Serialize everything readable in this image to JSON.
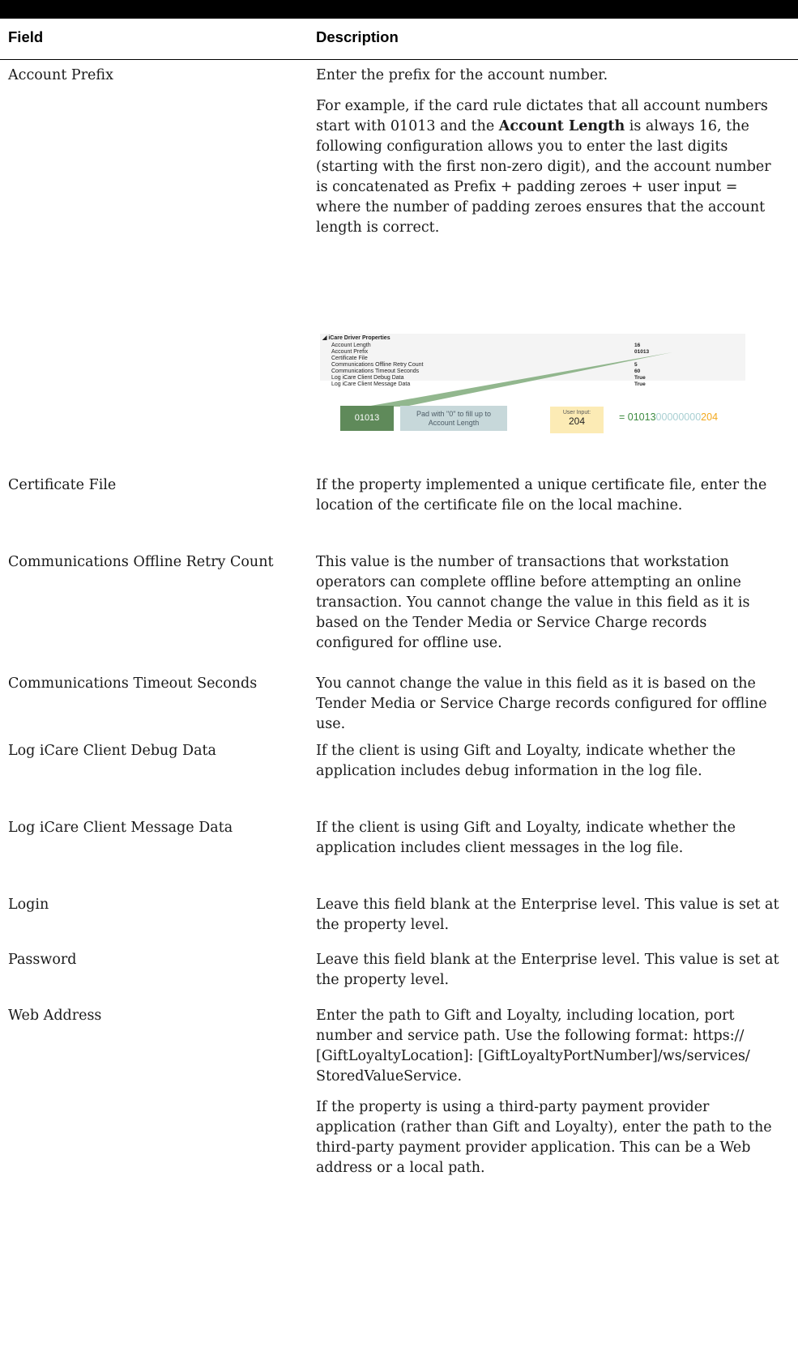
{
  "table": {
    "headers": {
      "field": "Field",
      "description": "Description"
    },
    "rows": [
      {
        "field": "Account Prefix",
        "desc": [
          "Enter the prefix for the account number.",
          "For example, if the card rule dictates that all account numbers start with 01013 and the",
          "Account Length",
          "is always 16, the following configuration allows you to enter the last digits (starting with the first non-zero digit), and the account number is concatenated as Prefix + padding zeroes + user input = where the number of padding zeroes ensures that the account length is correct."
        ]
      },
      {
        "field": "Certificate File",
        "desc": [
          "If the property implemented a unique certificate file, enter the location of the certificate file on the local machine."
        ]
      },
      {
        "field": "Communications Offline Retry Count",
        "desc": [
          "This value is the number of transactions that workstation operators can complete offline before attempting an online transaction. You cannot change the value in this field as it is based on the Tender Media or Service Charge records configured for offline use."
        ]
      },
      {
        "field": "Communications Timeout Seconds",
        "desc": [
          "You cannot change the value in this field as it is based on the Tender Media or Service Charge records configured for offline use."
        ]
      },
      {
        "field": "Log iCare Client Debug Data",
        "desc": [
          "If the client is using Gift and Loyalty, indicate whether the application includes debug information in the log file."
        ]
      },
      {
        "field": "Log iCare Client Message Data",
        "desc": [
          "If the client is using Gift and Loyalty, indicate whether the application includes client messages in the log file."
        ]
      },
      {
        "field": "Login",
        "desc": [
          "Leave this field blank at the Enterprise level. This value is set at the property level."
        ]
      },
      {
        "field": "Password",
        "desc": [
          "Leave this field blank at the Enterprise level. This value is set at the property level."
        ]
      },
      {
        "field": "Web Address",
        "desc": [
          "Enter the path to Gift and Loyalty, including location, port number and service path. Use the following format: https:// [GiftLoyaltyLocation]: [GiftLoyaltyPortNumber]/ws/services/ StoredValueService.",
          "If the property is using a third-party payment provider application (rather than Gift and Loyalty), enter the path to the third-party payment provider application. This can be a Web address or a local path."
        ]
      }
    ]
  },
  "figure": {
    "properties_title": "iCare Driver Properties",
    "properties": [
      {
        "name": "Account Length",
        "value": "16"
      },
      {
        "name": "Account Prefix",
        "value": "01013"
      },
      {
        "name": "Certificate File",
        "value": ""
      },
      {
        "name": "Communications Offline Retry Count",
        "value": "5"
      },
      {
        "name": "Communications Timeout Seconds",
        "value": "60"
      },
      {
        "name": "Log iCare Client Debug Data",
        "value": "True"
      },
      {
        "name": "Log iCare Client Message Data",
        "value": "True"
      }
    ],
    "prefix_box": "01013",
    "pad_box": "Pad with \"0\" to fill up to Account Length",
    "user_input_label": "User Input:",
    "user_input_value": "204",
    "result_prefix": "= 01013",
    "result_zeros": "00000000",
    "result_input": "204",
    "colors": {
      "prefix": "#5f8a5a",
      "pad": "#c7d8da",
      "input": "#fcebb5",
      "result_green": "#3d8b40",
      "result_zero": "#a8cfd2",
      "result_yellow": "#f2a81d"
    }
  }
}
